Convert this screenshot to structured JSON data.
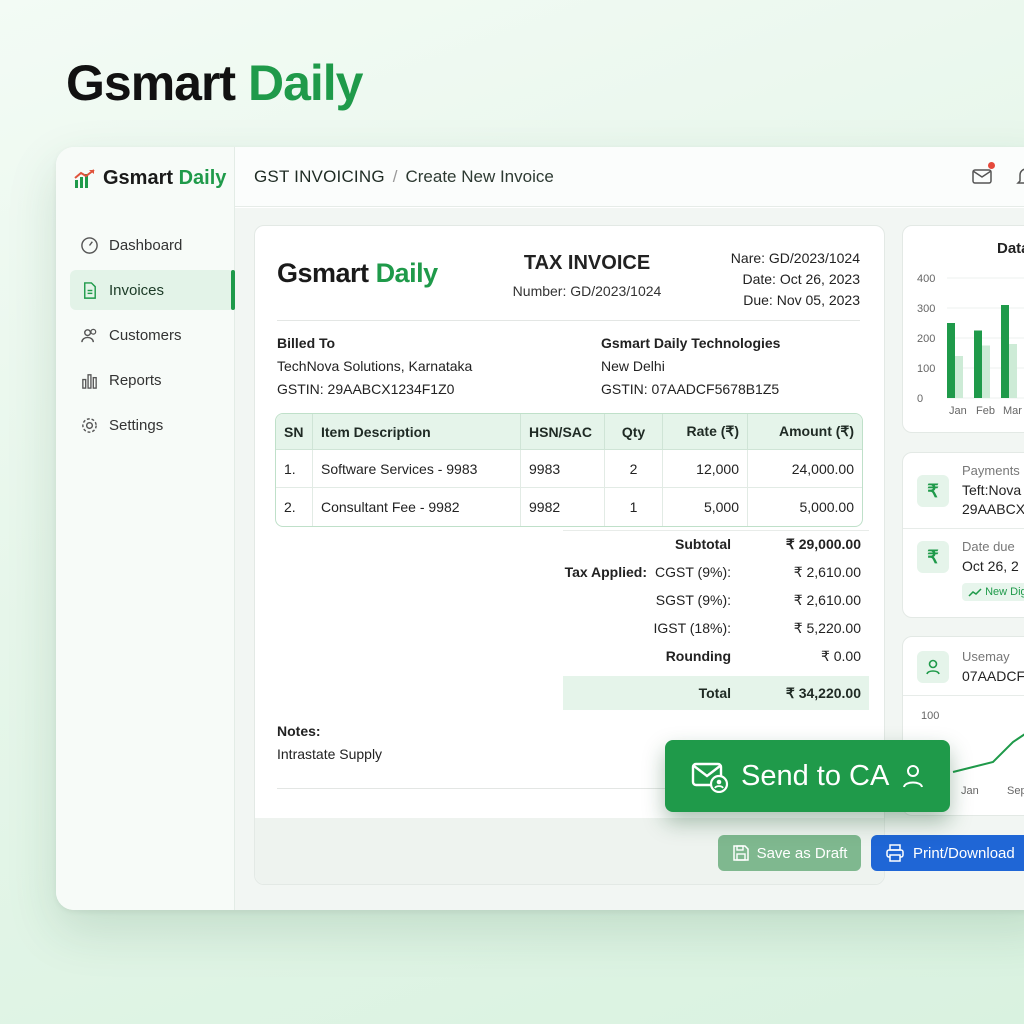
{
  "brand": {
    "part1": "Gsmart",
    "part2": "Daily"
  },
  "sidebar": {
    "logo_part1": "Gsmart",
    "logo_part2": "Daily",
    "items": [
      {
        "label": "Dashboard",
        "icon": "gauge-icon"
      },
      {
        "label": "Invoices",
        "icon": "document-icon",
        "active": true
      },
      {
        "label": "Customers",
        "icon": "users-icon"
      },
      {
        "label": "Reports",
        "icon": "bar-chart-icon"
      },
      {
        "label": "Settings",
        "icon": "gear-icon"
      }
    ]
  },
  "header": {
    "section": "GST INVOICING",
    "separator": "/",
    "page": "Create New Invoice"
  },
  "invoice": {
    "logo_part1": "Gsmart",
    "logo_part2": "Daily",
    "title": "TAX INVOICE",
    "number": "Number: GD/2023/1024",
    "meta": [
      "Nare: GD/2023/1024",
      "Date: Oct 26, 2023",
      "Due: Nov 05, 2023"
    ],
    "billed_to": {
      "heading": "Billed To",
      "name": "TechNova Solutions, Karnataka",
      "gstin": "GSTIN: 29AABCX1234F1Z0"
    },
    "seller": {
      "name": "Gsmart Daily Technologies",
      "city": "New Delhi",
      "gstin": "GSTIN: 07AADCF5678B1Z5"
    },
    "columns": [
      "SN",
      "Item Description",
      "HSN/SAC",
      "Qty",
      "Rate (₹)",
      "Amount (₹)"
    ],
    "rows": [
      [
        "1.",
        "Software Services - 9983",
        "9983",
        "2",
        "12,000",
        "24,000.00"
      ],
      [
        "2.",
        "Consultant Fee - 9982",
        "9982",
        "1",
        "5,000",
        "5,000.00"
      ]
    ],
    "subtotal_label": "Subtotal",
    "subtotal_value": "₹ 29,000.00",
    "tax_applied_label": "Tax Applied:",
    "cgst_label": "CGST (9%):",
    "cgst_value": "₹ 2,610.00",
    "sgst_label": "SGST (9%):",
    "sgst_value": "₹ 2,610.00",
    "igst_label": "IGST (18%):",
    "igst_value": "₹ 5,220.00",
    "rounding_label": "Rounding",
    "rounding_value": "₹ 0.00",
    "total_label": "Total",
    "total_value": "₹ 34,220.00",
    "notes_heading": "Notes:",
    "notes_text": "Intrastate Supply"
  },
  "actions": {
    "send": "Send to CA",
    "draft": "Save as Draft",
    "print": "Print/Download"
  },
  "chart_card": {
    "title": "Data",
    "chart_data": {
      "type": "bar",
      "categories": [
        "Jan",
        "Feb",
        "Mar"
      ],
      "series": [
        {
          "values": [
            250,
            225,
            310
          ]
        },
        {
          "values": [
            140,
            175,
            180
          ]
        }
      ],
      "yticks": [
        "400",
        "300",
        "200",
        "100",
        "0"
      ],
      "ylim": [
        0,
        400
      ]
    }
  },
  "payments_card": {
    "label1": "Payments",
    "value1a": "Teft:Nova",
    "value1b": "29AABCX",
    "label2": "Date due",
    "value2": "Oct 26, 2",
    "pill": "New Dig"
  },
  "usage_card": {
    "label": "Usemay",
    "value": "07AADCF",
    "ytick": "100",
    "xticks": [
      "Jan",
      "Sep"
    ]
  },
  "colors": {
    "accent": "#1f9a4a",
    "primary_blue": "#1f66d6",
    "draft_green": "#7fb88f",
    "notification": "#e5493b"
  }
}
